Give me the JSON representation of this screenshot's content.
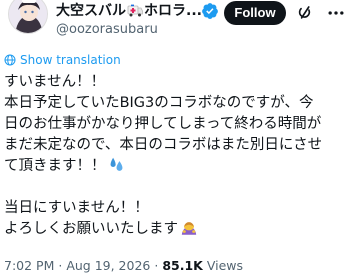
{
  "header": {
    "display_name": "大空スバル",
    "display_name_suffix": "ホロラ...",
    "handle": "@oozorasubaru",
    "follow_label": "Follow"
  },
  "translation": {
    "label": "Show translation"
  },
  "body": {
    "lines": [
      "すいません！！",
      "本日予定していたBIG3のコラボなのですが、今",
      "日のお仕事がかなり押してしまって終わる時間が",
      "まだ未定なので、本日のコラボはまた別日にさせ",
      "て頂きます！！",
      "",
      "当日にすいません！！",
      "よろしくお願いいたします"
    ]
  },
  "meta": {
    "time": "7:02 PM",
    "sep": "·",
    "date": "Aug 19, 2026",
    "views_count": "85.1K",
    "views_label": "Views"
  },
  "colors": {
    "accent": "#1d9bf0",
    "text": "#0f1419",
    "secondary": "#536471",
    "follow_bg": "#0f1419"
  },
  "icons": [
    "ambulance-icon",
    "verified-icon",
    "grok-icon",
    "more-icon",
    "globe-icon",
    "sweat-droplets-icon",
    "bowing-person-icon"
  ]
}
